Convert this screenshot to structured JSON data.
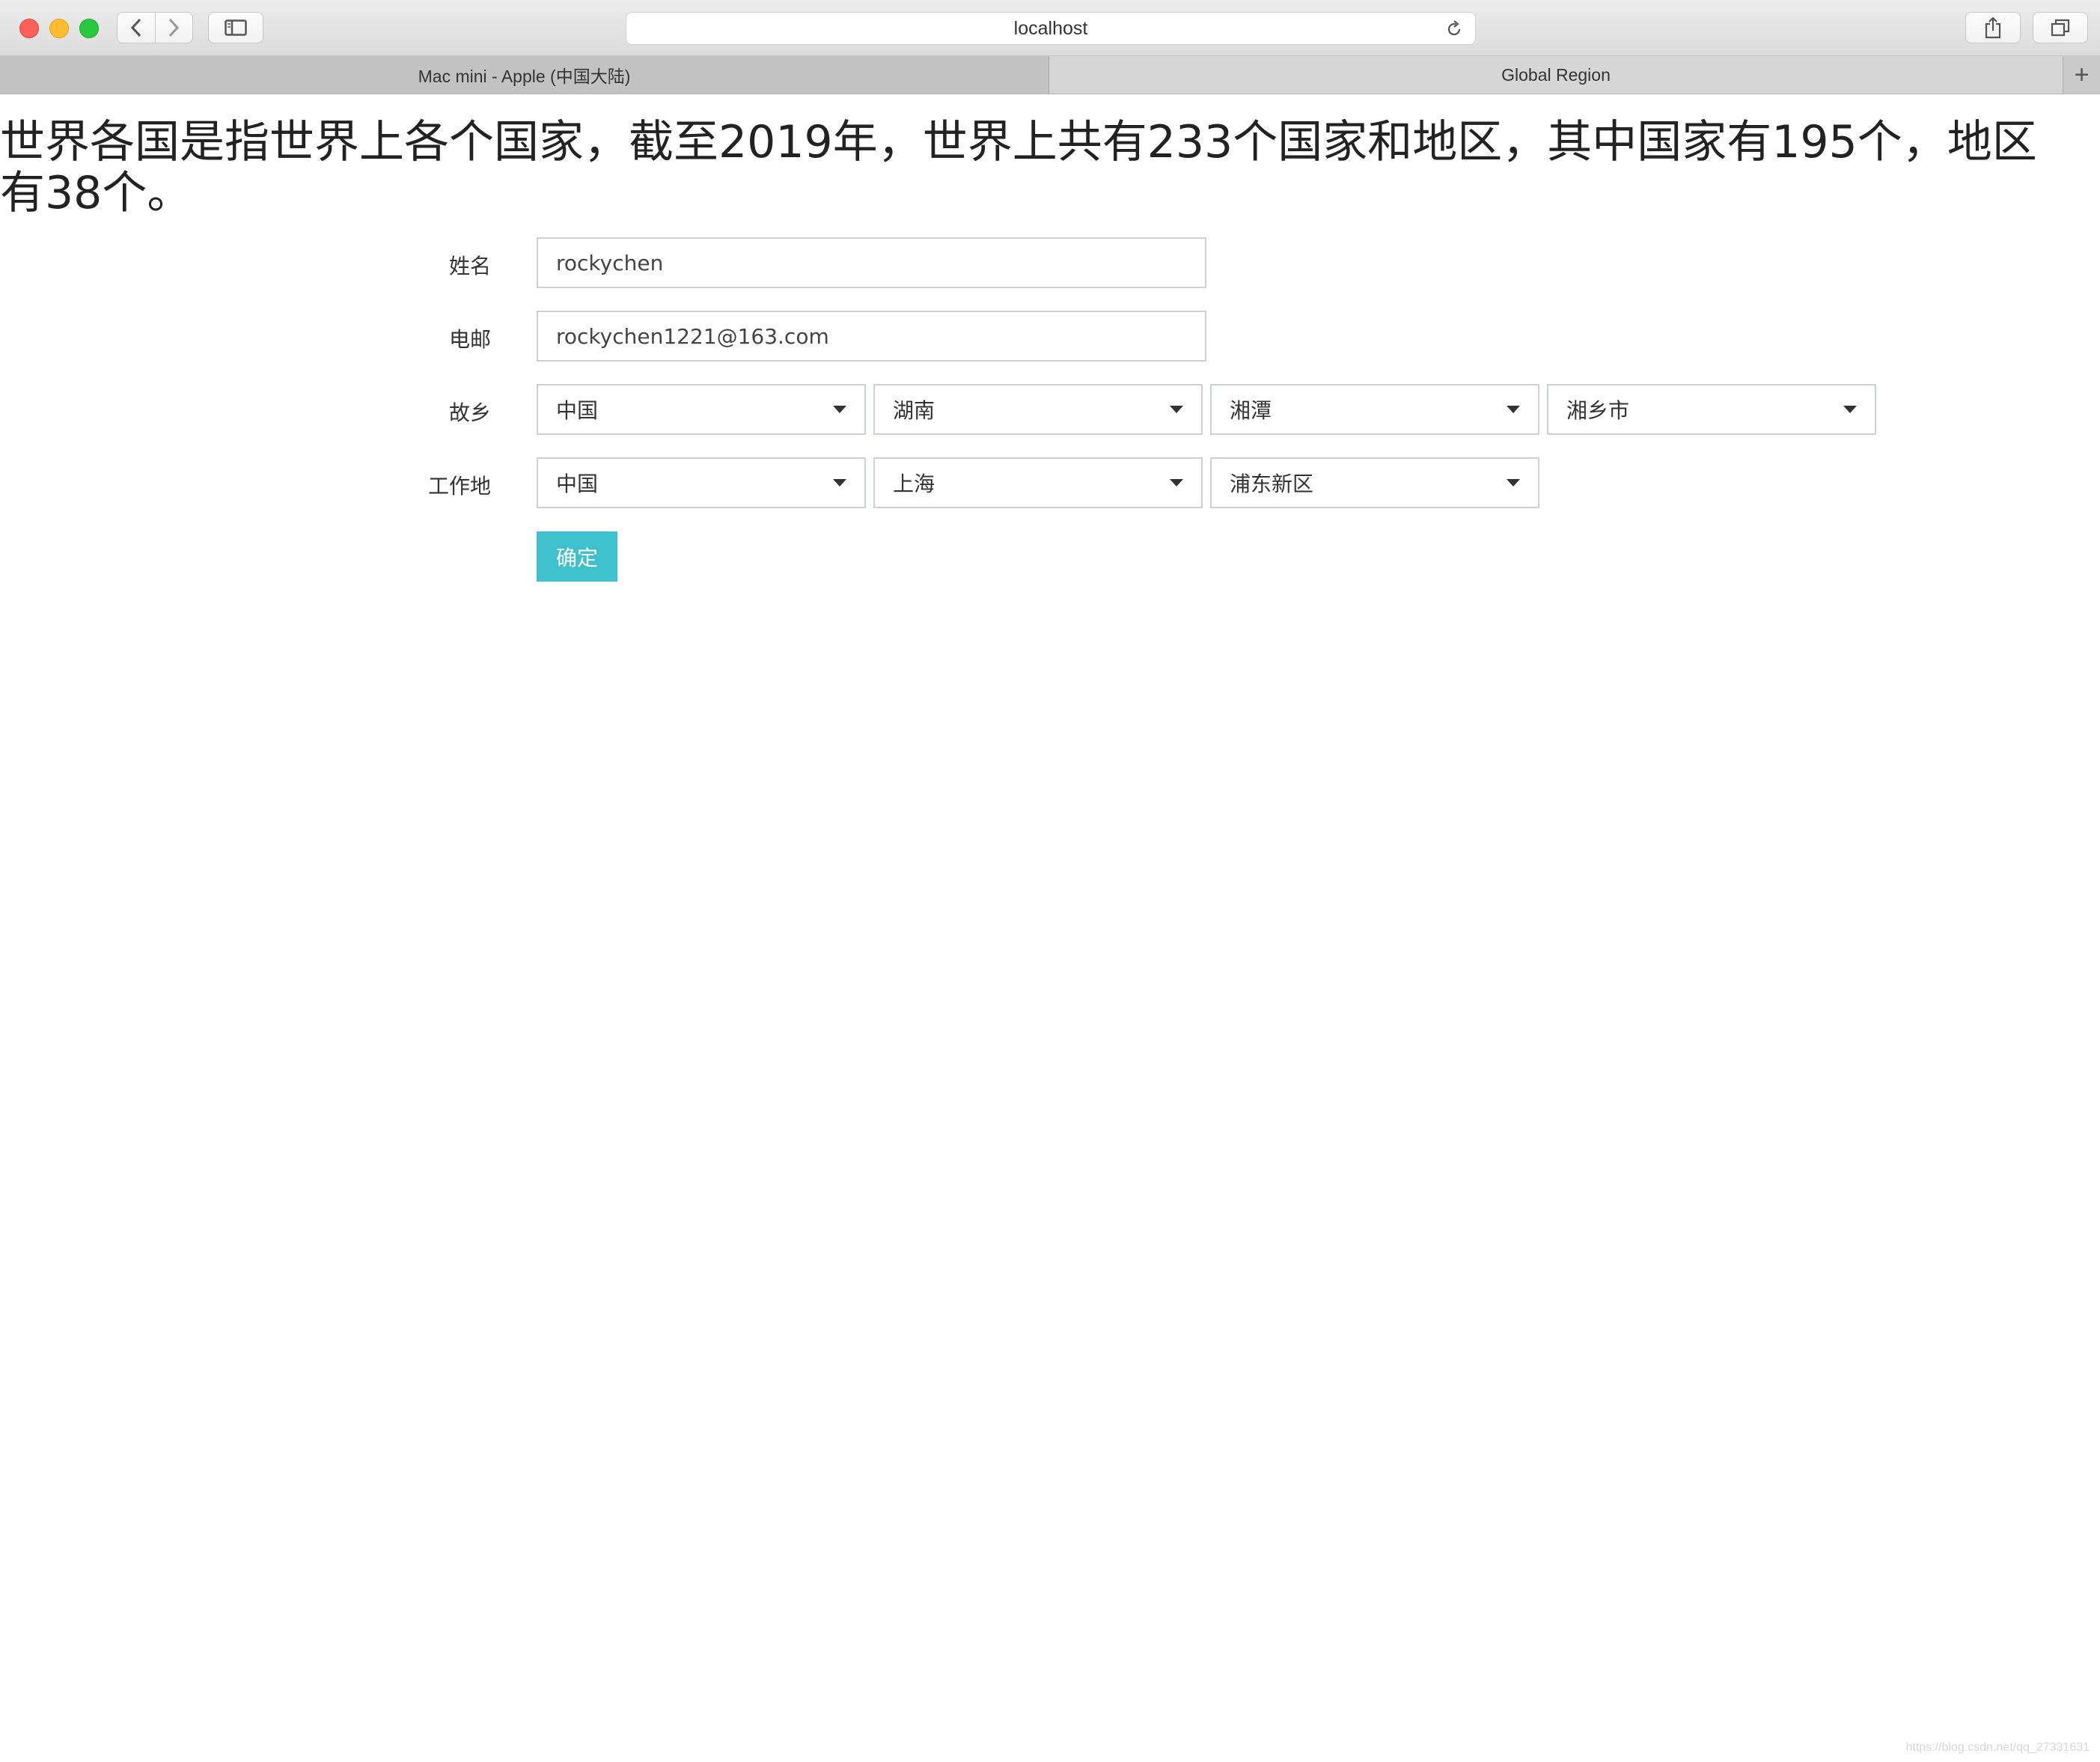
{
  "browser": {
    "address": "localhost",
    "tabs": [
      {
        "label": "Mac mini - Apple (中国大陆)"
      },
      {
        "label": "Global Region"
      }
    ],
    "new_tab_label": "+"
  },
  "headline": "世界各国是指世界上各个国家，截至2019年，世界上共有233个国家和地区，其中国家有195个，地区有38个。",
  "form": {
    "name": {
      "label": "姓名",
      "value": "rockychen"
    },
    "email": {
      "label": "电邮",
      "value": "rockychen1221@163.com"
    },
    "hometown": {
      "label": "故乡",
      "selects": [
        "中国",
        "湖南",
        "湘潭",
        "湘乡市"
      ]
    },
    "workplace": {
      "label": "工作地",
      "selects": [
        "中国",
        "上海",
        "浦东新区"
      ]
    },
    "submit_label": "确定"
  },
  "watermark": "https://blog.csdn.net/qq_27331631"
}
